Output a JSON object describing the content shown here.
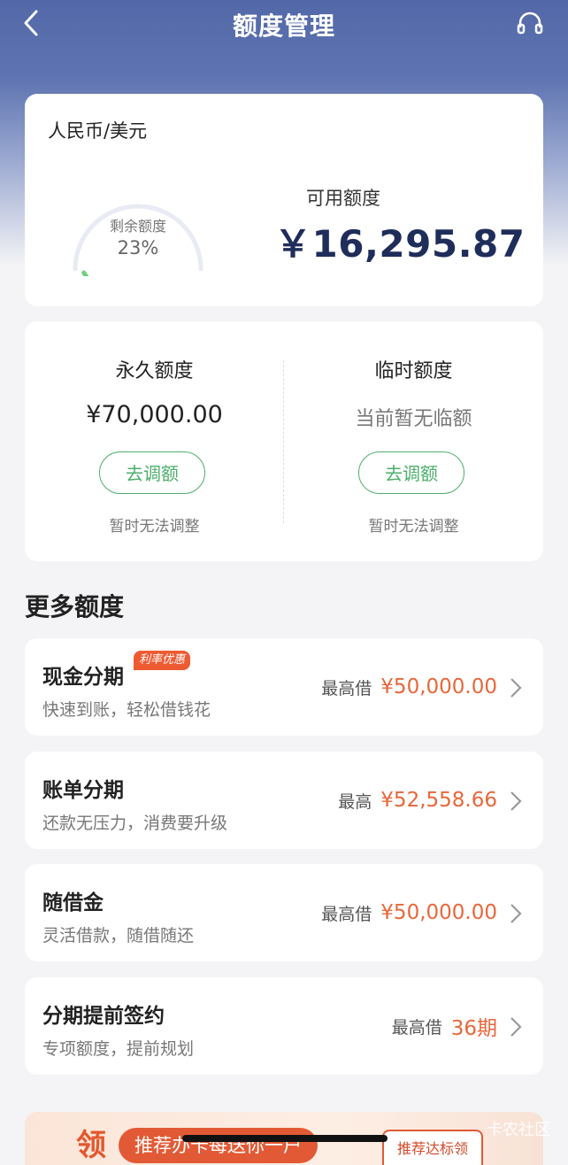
{
  "nav": {
    "title": "额度管理",
    "back_icon": "chevron-left-icon",
    "service_icon": "headset-icon"
  },
  "summary": {
    "currency": "人民币/美元",
    "gauge_label": "剩余额度",
    "gauge_value": "23%",
    "gauge_fraction": 0.23,
    "available_label": "可用额度",
    "available_value": "￥16,295.87"
  },
  "limits": {
    "permanent": {
      "title": "永久额度",
      "amount": "¥70,000.00",
      "button": "去调额",
      "note": "暂时无法调整"
    },
    "temporary": {
      "title": "临时额度",
      "amount": "当前暂无临额",
      "button": "去调额",
      "note": "暂时无法调整"
    }
  },
  "more": {
    "title": "更多额度",
    "items": [
      {
        "name": "现金分期",
        "badge": "利率优惠",
        "desc": "快速到账，轻松借钱花",
        "prefix": "最高借",
        "value": "¥50,000.00"
      },
      {
        "name": "账单分期",
        "desc": "还款无压力，消费要升级",
        "prefix": "最高",
        "value": "¥52,558.66"
      },
      {
        "name": "随借金",
        "desc": "灵活借款，随借随还",
        "prefix": "最高借",
        "value": "¥50,000.00"
      },
      {
        "name": "分期提前签约",
        "desc": "专项额度，提前规划",
        "prefix": "最高借",
        "value": "36期"
      }
    ]
  },
  "banner": {
    "big": "领",
    "pill": "推荐办卡每送你一户",
    "box": "推荐达标领"
  },
  "watermark": "卡农社区",
  "colors": {
    "header": "#5368a8",
    "accent_green": "#4caf6a",
    "amount_orange": "#e8673a",
    "amount_navy": "#1f2d5a"
  }
}
